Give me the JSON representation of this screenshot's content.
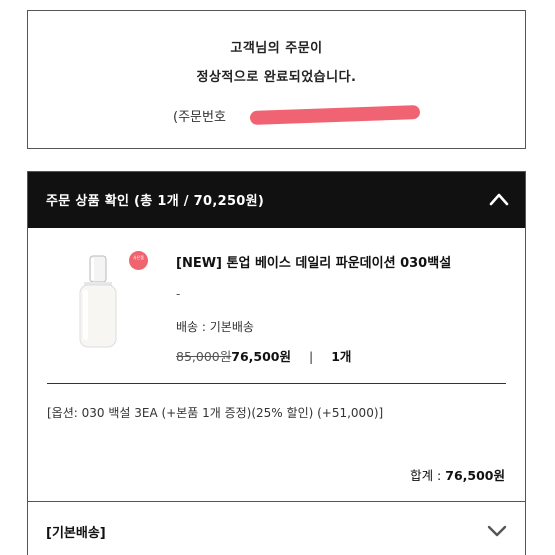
{
  "confirm": {
    "line1": "고객님의 주문이",
    "line2": "정상적으로 완료되었습니다.",
    "order_number_prefix": "(주문번호"
  },
  "section": {
    "title": "주문 상품 확인 (총 1개 / 70,250원)"
  },
  "product": {
    "badge": "사은품",
    "name": "[NEW] 톤업 베이스 데일리 파운데이션 030백설",
    "option_placeholder": "-",
    "shipping": "배송 : 기본배송",
    "original_price": "85,000원",
    "sale_price": "76,500원",
    "separator": "|",
    "quantity": "1개",
    "option_detail": "[옵션: 030 백설 3EA (+본품 1개 증정)(25% 할인) (+51,000)]",
    "total_label": "합계 : ",
    "total_value": "76,500원"
  },
  "shipping_section": {
    "title": "[기본배송]"
  },
  "colors": {
    "header_bg": "#111111",
    "redaction": "#ef5b6c",
    "badge": "#f0646f"
  }
}
